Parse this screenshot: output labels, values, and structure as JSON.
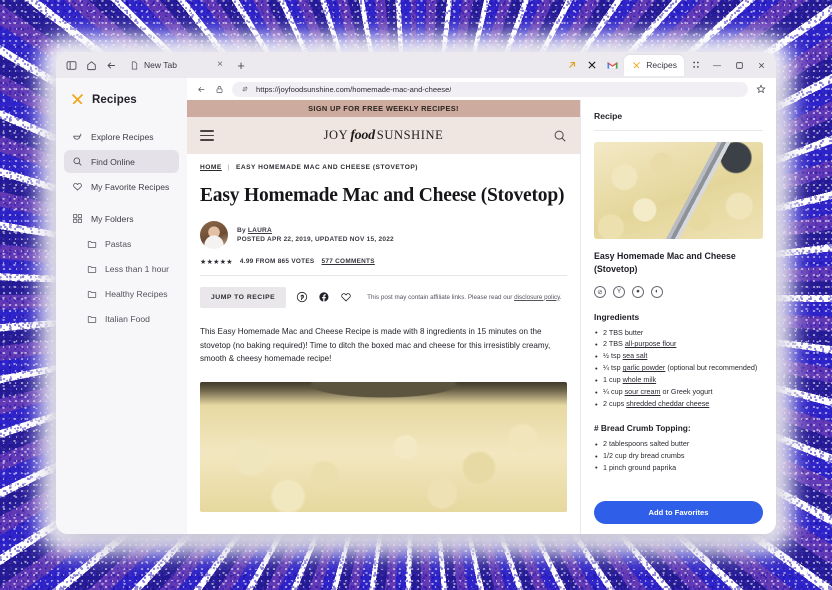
{
  "browser": {
    "toolbar_icons": [
      "sidebar-toggle-icon",
      "home-icon",
      "back-icon"
    ],
    "tabs": [
      {
        "title": "New Tab",
        "favicon": "page-icon",
        "active": false,
        "close": "×"
      },
      {
        "title": "Recipes",
        "favicon": "recipes-logo-icon",
        "active": true
      }
    ],
    "new_tab_label": "+",
    "right_icons": [
      "share-arrow-icon",
      "x-icon",
      "gmail-icon"
    ],
    "window_controls": {
      "minimize": "—",
      "maximize": "□",
      "close": "×"
    },
    "grid_icon": "apps-grid-icon",
    "url": "https://joyfoodsunshine.com/homemade-mac-and-cheese/",
    "url_icons": [
      "back-icon",
      "lock-icon",
      "switch-icon"
    ],
    "bookmark_icon": "star-icon"
  },
  "sidebar": {
    "brand": "Recipes",
    "items": [
      {
        "label": "Explore Recipes",
        "icon": "bowl-icon",
        "selected": false
      },
      {
        "label": "Find Online",
        "icon": "search-icon",
        "selected": true
      },
      {
        "label": "My Favorite Recipes",
        "icon": "heart-icon",
        "selected": false
      },
      {
        "label": "My Folders",
        "icon": "folders-grid-icon",
        "selected": false
      }
    ],
    "folders": [
      {
        "label": "Pastas",
        "icon": "folder-icon"
      },
      {
        "label": "Less than 1 hour",
        "icon": "folder-icon"
      },
      {
        "label": "Healthy Recipes",
        "icon": "folder-icon"
      },
      {
        "label": "Italian Food",
        "icon": "folder-icon"
      }
    ]
  },
  "webpage": {
    "promo_banner": "SIGN UP FOR FREE WEEKLY RECIPES!",
    "site_logo": {
      "part1": "JOY",
      "part2": "food",
      "part3": "SUNSHINE"
    },
    "breadcrumb": {
      "home": "HOME",
      "separator": "|",
      "current": "EASY HOMEMADE MAC AND CHEESE (STOVETOP)"
    },
    "article_title": "Easy Homemade Mac and Cheese (Stovetop)",
    "byline_prefix": "By",
    "author": "LAURA",
    "dates": "POSTED APR 22, 2019, UPDATED NOV 15, 2022",
    "stars": "★★★★★",
    "rating_text": "4.99 FROM 865 VOTES",
    "comments": "577 COMMENTS",
    "jump_to_recipe": "JUMP TO RECIPE",
    "share_icons": [
      "pinterest-icon",
      "facebook-icon",
      "heart-icon"
    ],
    "affiliate_text": "This post may contain affiliate links. Please read our",
    "affiliate_link": "disclosure policy",
    "affiliate_period": ".",
    "lede": "This Easy Homemade Mac and Cheese Recipe is made with 8 ingredients in 15 minutes on the stovetop (no baking required)! Time to ditch the boxed mac and cheese for this irresistibly creamy, smooth & cheesy homemade recipe!"
  },
  "recipe_panel": {
    "header": "Recipe",
    "recipe_title": "Easy Homemade Mac and Cheese (Stovetop)",
    "diet_icons": [
      "no-gluten-icon",
      "vegetarian-icon",
      "dairy-icon",
      "no-nuts-icon"
    ],
    "diet_glyphs": [
      "⊘",
      "Y",
      "●",
      "◐"
    ],
    "ingredients_header": "Ingredients",
    "ingredients": [
      {
        "amount": "2 TBS ",
        "item": "butter",
        "link": false,
        "suffix": ""
      },
      {
        "amount": "2 TBS ",
        "item": "all-purpose flour",
        "link": true,
        "suffix": ""
      },
      {
        "amount": "½ tsp ",
        "item": "sea salt",
        "link": true,
        "suffix": ""
      },
      {
        "amount": "¼ tsp ",
        "item": "garlic powder",
        "link": true,
        "suffix": " (optional but recommended)"
      },
      {
        "amount": "1 cup ",
        "item": "whole milk",
        "link": true,
        "suffix": ""
      },
      {
        "amount": "¼ cup ",
        "item": "sour cream",
        "link": true,
        "suffix": " or Greek yogurt"
      },
      {
        "amount": "2 cups ",
        "item": "shredded cheddar cheese",
        "link": true,
        "suffix": ""
      }
    ],
    "topping_header": "# Bread Crumb Topping:",
    "topping": [
      {
        "amount": "2 tablespoons salted butter",
        "item": "",
        "link": false,
        "suffix": ""
      },
      {
        "amount": "1/2 cup dry bread crumbs",
        "item": "",
        "link": false,
        "suffix": ""
      },
      {
        "amount": "1 pinch ground paprika",
        "item": "",
        "link": false,
        "suffix": ""
      }
    ],
    "add_to_favorites": "Add to Favorites",
    "accent_color": "#2f5fe8"
  }
}
